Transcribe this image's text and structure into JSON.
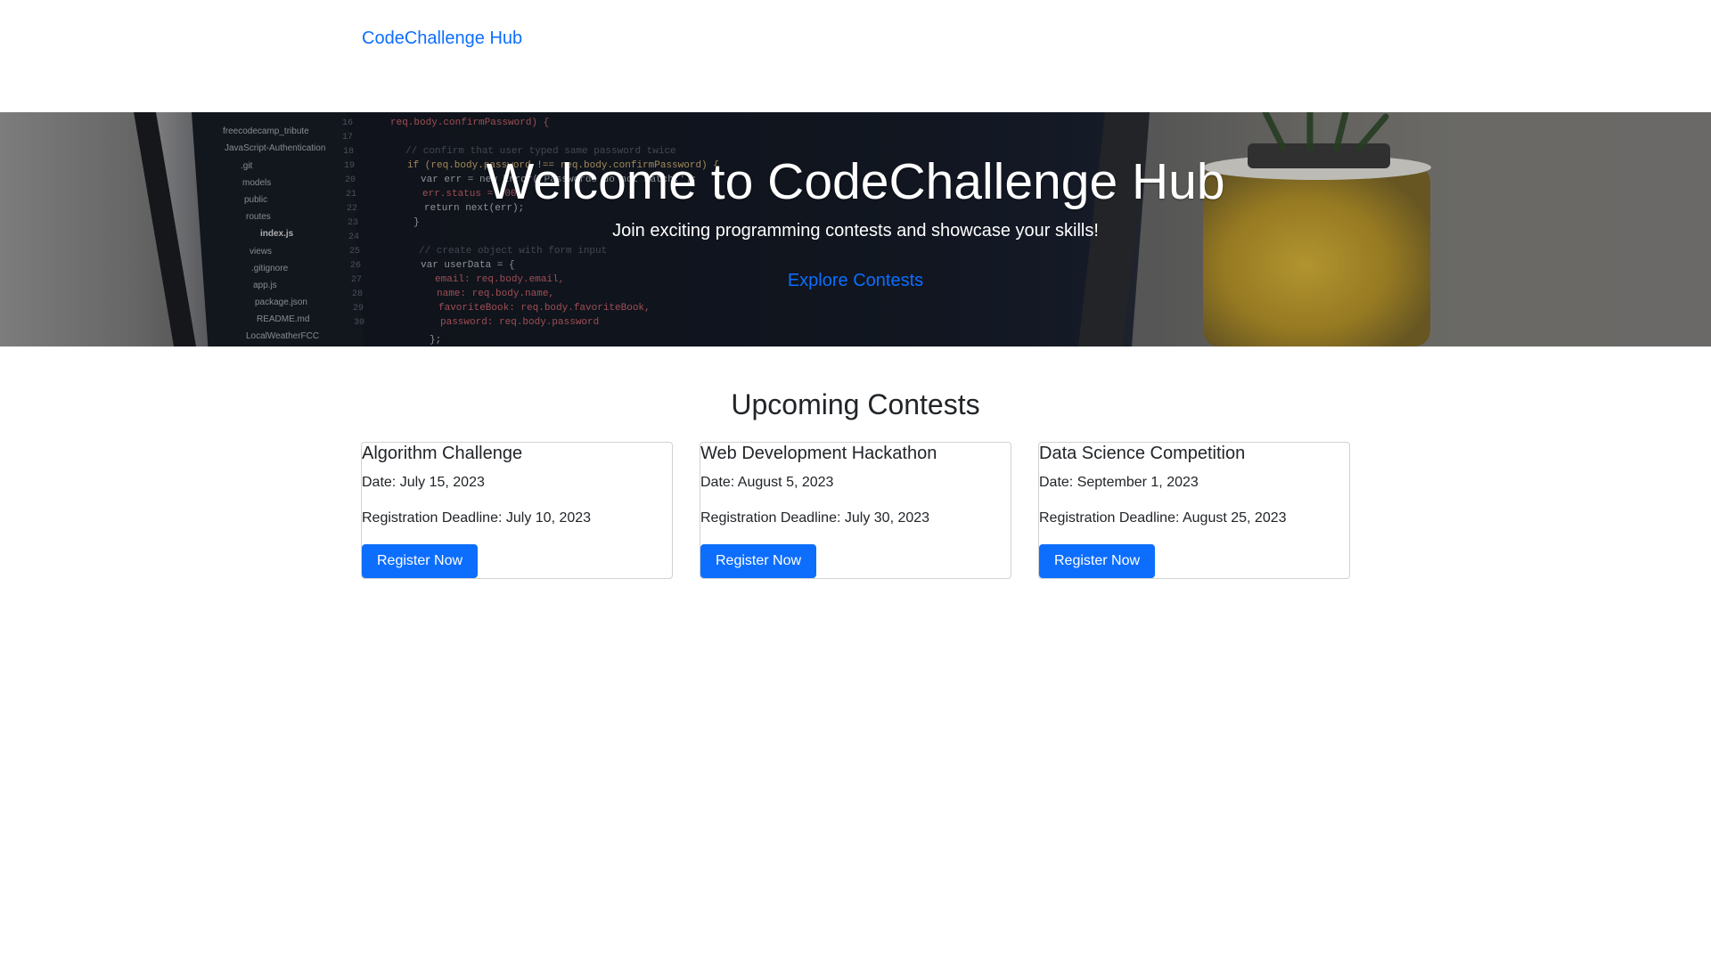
{
  "navbar": {
    "brand": "CodeChallenge Hub"
  },
  "hero": {
    "title": "Welcome to CodeChallenge Hub",
    "subtitle": "Join exciting programming contests and showcase your skills!",
    "cta_label": "Explore Contests",
    "background_image": "laptop-code-editor-photo",
    "file_tree": [
      "freecodecamp_tribute",
      "JavaScript-Authentication",
      ".git",
      "models",
      "public",
      "routes",
      "index.js",
      "views",
      ".gitignore",
      "app.js",
      "package.json",
      "README.md",
      "LocalWeatherFCC"
    ],
    "code_lines": [
      "req.body.confirmPassword) {",
      "// confirm that user typed same password twice",
      "if (req.body.password !== req.body.confirmPassword) {",
      "var err = new Error('Passwords do not match.');",
      "err.status = 400;",
      "return next(err);",
      "}",
      "// create object with form input",
      "var userData = {",
      "email: req.body.email,",
      "name: req.body.name,",
      "favoriteBook: req.body.favoriteBook,",
      "password: req.body.password",
      "};"
    ],
    "line_numbers": [
      "16",
      "17",
      "18",
      "19",
      "20",
      "21",
      "22",
      "23",
      "24",
      "25",
      "26",
      "27",
      "28",
      "29",
      "30"
    ]
  },
  "contests_section": {
    "title": "Upcoming Contests",
    "cards": [
      {
        "title": "Algorithm Challenge",
        "date": "Date: July 15, 2023",
        "deadline": "Registration Deadline: July 10, 2023",
        "button_label": "Register Now"
      },
      {
        "title": "Web Development Hackathon",
        "date": "Date: August 5, 2023",
        "deadline": "Registration Deadline: July 30, 2023",
        "button_label": "Register Now"
      },
      {
        "title": "Data Science Competition",
        "date": "Date: September 1, 2023",
        "deadline": "Registration Deadline: August 25, 2023",
        "button_label": "Register Now"
      }
    ]
  },
  "colors": {
    "primary": "#0d6efd",
    "text": "#212529",
    "hero_text": "#ffffff"
  }
}
